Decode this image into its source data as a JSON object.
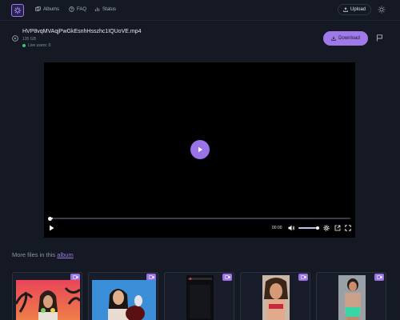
{
  "nav": {
    "albums_label": "Albums",
    "faq_label": "FAQ",
    "status_label": "Status",
    "upload_label": "Upload"
  },
  "file": {
    "name": "HVP8vqMVAqjPwGkEsnhHsszhc1IQUoVE.mp4",
    "size": "135 GB",
    "live_users": "Live users: 0",
    "download_label": "Download"
  },
  "player": {
    "time": "00:00",
    "progress": 0.01,
    "volume": 0.9
  },
  "more": {
    "prefix": "More files in this ",
    "link": "album"
  },
  "colors": {
    "accent": "#9d7ae8",
    "background": "#141923",
    "live_dot": "#3fc46a"
  },
  "icons": [
    "logo-icon",
    "albums-icon",
    "faq-icon",
    "status-icon",
    "upload-icon",
    "sun-icon",
    "play-circle-icon",
    "download-icon",
    "flag-icon",
    "play-icon",
    "volume-icon",
    "settings-icon",
    "external-icon",
    "fullscreen-icon",
    "video-badge-icon"
  ]
}
